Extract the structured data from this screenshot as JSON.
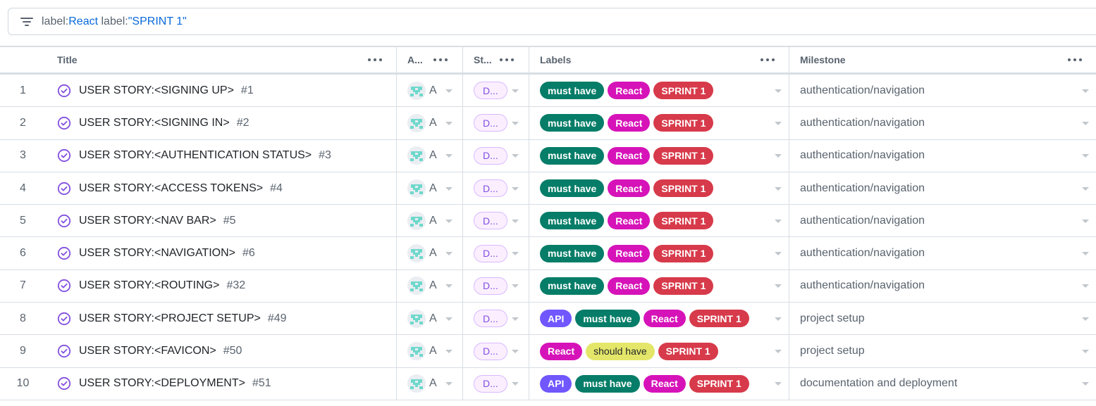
{
  "filter": {
    "tokens": [
      {
        "key": "label:",
        "value": "React"
      },
      {
        "key": " label:",
        "value": "\"SPRINT 1\""
      }
    ]
  },
  "columns": {
    "title": "Title",
    "assignees": "A...",
    "status": "St...",
    "labels": "Labels",
    "milestone": "Milestone"
  },
  "label_colors": {
    "must have": {
      "bg": "#067d68",
      "fg": "#ffffff"
    },
    "React": {
      "bg": "#d613b8",
      "fg": "#ffffff"
    },
    "SPRINT 1": {
      "bg": "#d73a4a",
      "fg": "#ffffff"
    },
    "API": {
      "bg": "#7057ff",
      "fg": "#ffffff"
    },
    "should have": {
      "bg": "#e4e669",
      "fg": "#1f2328"
    }
  },
  "rows": [
    {
      "index": "1",
      "title": "USER STORY:<SIGNING UP>",
      "number": "#1",
      "assignee": "A",
      "status": "D...",
      "labels": [
        "must have",
        "React",
        "SPRINT 1"
      ],
      "milestone": "authentication/navigation"
    },
    {
      "index": "2",
      "title": "USER STORY:<SIGNING IN>",
      "number": "#2",
      "assignee": "A",
      "status": "D...",
      "labels": [
        "must have",
        "React",
        "SPRINT 1"
      ],
      "milestone": "authentication/navigation"
    },
    {
      "index": "3",
      "title": "USER STORY:<AUTHENTICATION STATUS>",
      "number": "#3",
      "assignee": "A",
      "status": "D...",
      "labels": [
        "must have",
        "React",
        "SPRINT 1"
      ],
      "milestone": "authentication/navigation"
    },
    {
      "index": "4",
      "title": "USER STORY:<ACCESS TOKENS>",
      "number": "#4",
      "assignee": "A",
      "status": "D...",
      "labels": [
        "must have",
        "React",
        "SPRINT 1"
      ],
      "milestone": "authentication/navigation"
    },
    {
      "index": "5",
      "title": "USER STORY:<NAV BAR>",
      "number": "#5",
      "assignee": "A",
      "status": "D...",
      "labels": [
        "must have",
        "React",
        "SPRINT 1"
      ],
      "milestone": "authentication/navigation"
    },
    {
      "index": "6",
      "title": "USER STORY:<NAVIGATION>",
      "number": "#6",
      "assignee": "A",
      "status": "D...",
      "labels": [
        "must have",
        "React",
        "SPRINT 1"
      ],
      "milestone": "authentication/navigation"
    },
    {
      "index": "7",
      "title": "USER STORY:<ROUTING>",
      "number": "#32",
      "assignee": "A",
      "status": "D...",
      "labels": [
        "must have",
        "React",
        "SPRINT 1"
      ],
      "milestone": "authentication/navigation"
    },
    {
      "index": "8",
      "title": "USER STORY:<PROJECT SETUP>",
      "number": "#49",
      "assignee": "A",
      "status": "D...",
      "labels": [
        "API",
        "must have",
        "React",
        "SPRINT 1"
      ],
      "milestone": "project setup"
    },
    {
      "index": "9",
      "title": "USER STORY:<FAVICON>",
      "number": "#50",
      "assignee": "A",
      "status": "D...",
      "labels": [
        "React",
        "should have",
        "SPRINT 1"
      ],
      "milestone": "project setup"
    },
    {
      "index": "10",
      "title": "USER STORY:<DEPLOYMENT>",
      "number": "#51",
      "assignee": "A",
      "status": "D...",
      "labels": [
        "API",
        "must have",
        "React",
        "SPRINT 1"
      ],
      "milestone": "documentation and deployment"
    }
  ]
}
